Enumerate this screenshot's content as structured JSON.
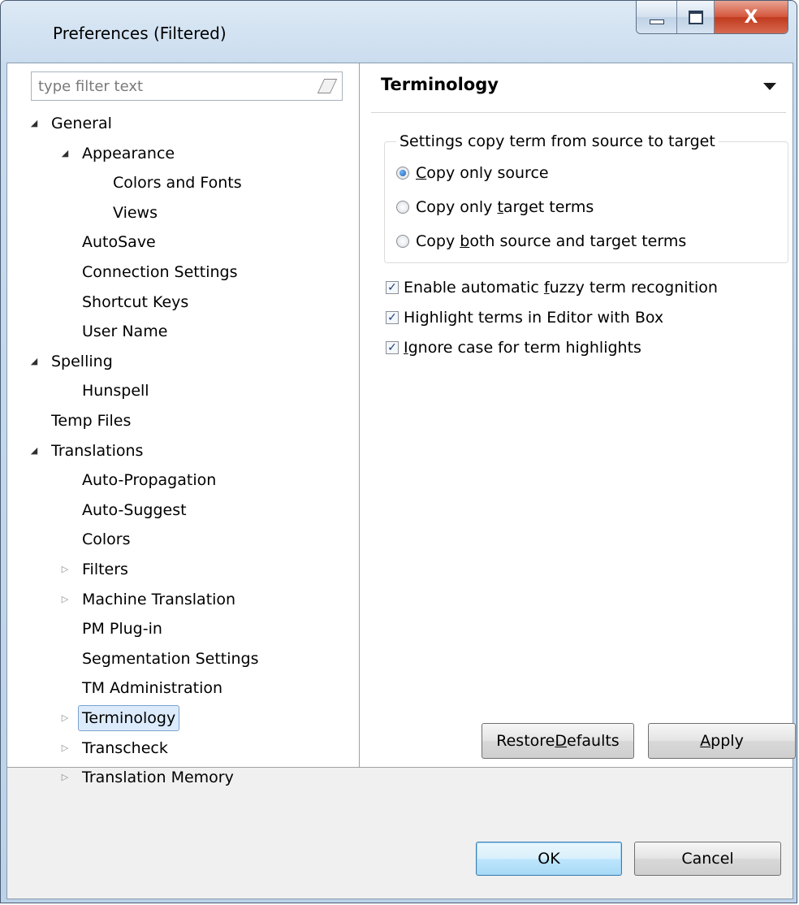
{
  "window": {
    "title": "Preferences (Filtered)",
    "controls": {
      "minimize": "",
      "maximize": "",
      "close": "X"
    }
  },
  "filter": {
    "placeholder": "type filter text",
    "value": ""
  },
  "tree": [
    {
      "label": "General",
      "level": 0,
      "expander": "open"
    },
    {
      "label": "Appearance",
      "level": 1,
      "expander": "open"
    },
    {
      "label": "Colors and Fonts",
      "level": 2,
      "expander": "none"
    },
    {
      "label": "Views",
      "level": 2,
      "expander": "none"
    },
    {
      "label": "AutoSave",
      "level": 1,
      "expander": "none"
    },
    {
      "label": "Connection Settings",
      "level": 1,
      "expander": "none"
    },
    {
      "label": "Shortcut Keys",
      "level": 1,
      "expander": "none"
    },
    {
      "label": "User Name",
      "level": 1,
      "expander": "none"
    },
    {
      "label": "Spelling",
      "level": 0,
      "expander": "open"
    },
    {
      "label": "Hunspell",
      "level": 1,
      "expander": "none"
    },
    {
      "label": "Temp Files",
      "level": 0,
      "expander": "none"
    },
    {
      "label": "Translations",
      "level": 0,
      "expander": "open"
    },
    {
      "label": "Auto-Propagation",
      "level": 1,
      "expander": "none"
    },
    {
      "label": "Auto-Suggest",
      "level": 1,
      "expander": "none"
    },
    {
      "label": "Colors",
      "level": 1,
      "expander": "none"
    },
    {
      "label": "Filters",
      "level": 1,
      "expander": "closed"
    },
    {
      "label": "Machine Translation",
      "level": 1,
      "expander": "closed"
    },
    {
      "label": "PM Plug-in",
      "level": 1,
      "expander": "none"
    },
    {
      "label": "Segmentation Settings",
      "level": 1,
      "expander": "none"
    },
    {
      "label": "TM Administration",
      "level": 1,
      "expander": "none"
    },
    {
      "label": "Terminology",
      "level": 1,
      "expander": "closed",
      "selected": true
    },
    {
      "label": "Transcheck",
      "level": 1,
      "expander": "closed"
    },
    {
      "label": "Translation Memory",
      "level": 1,
      "expander": "closed"
    }
  ],
  "page": {
    "title": "Terminology",
    "group": {
      "legend": "Settings copy term from source to target",
      "options": [
        {
          "before": "",
          "mnemonic": "C",
          "after": "opy only source",
          "checked": true
        },
        {
          "before": "Copy only ",
          "mnemonic": "t",
          "after": "arget terms",
          "checked": false
        },
        {
          "before": "Copy ",
          "mnemonic": "b",
          "after": "oth source and target terms",
          "checked": false
        }
      ]
    },
    "checkboxes": [
      {
        "before": "Enable automatic ",
        "mnemonic": "f",
        "after": "uzzy term recognition",
        "checked": true
      },
      {
        "before": "Highlight terms in Editor with Box",
        "mnemonic": "",
        "after": "",
        "checked": true
      },
      {
        "before": "",
        "mnemonic": "I",
        "after": "gnore case for term highlights",
        "checked": true
      }
    ],
    "restore_defaults": {
      "before": "Restore ",
      "mnemonic": "D",
      "after": "efaults"
    },
    "apply": {
      "before": "",
      "mnemonic": "A",
      "after": "pply"
    }
  },
  "footer": {
    "ok_label": "OK",
    "cancel_label": "Cancel"
  },
  "icons": {
    "expanded": "◢",
    "collapsed": "▷",
    "check": "✓"
  }
}
